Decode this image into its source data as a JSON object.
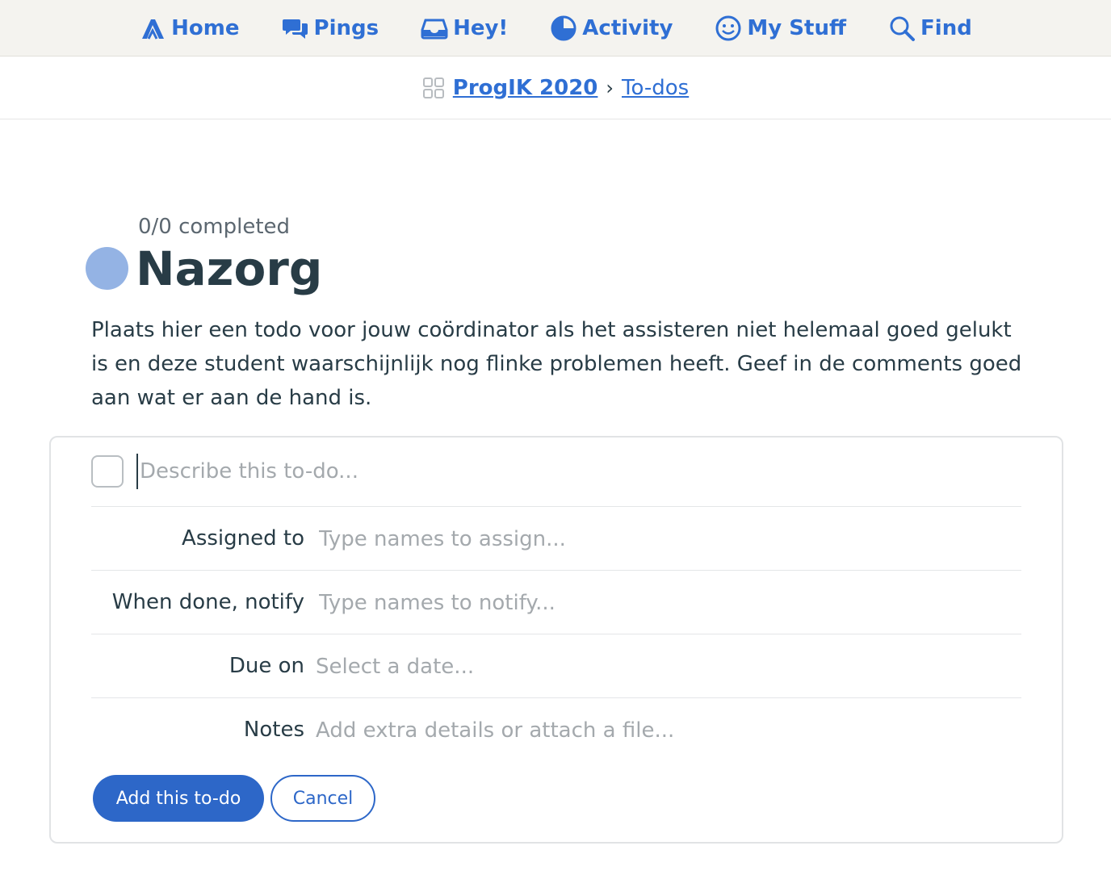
{
  "nav": {
    "items": [
      {
        "label": "Home",
        "icon": "home-icon"
      },
      {
        "label": "Pings",
        "icon": "pings-icon"
      },
      {
        "label": "Hey!",
        "icon": "hey-inbox-icon"
      },
      {
        "label": "Activity",
        "icon": "activity-icon"
      },
      {
        "label": "My Stuff",
        "icon": "smiley-icon"
      },
      {
        "label": "Find",
        "icon": "search-icon"
      }
    ]
  },
  "breadcrumb": {
    "project": "ProgIK 2020",
    "separator": "›",
    "section": "To-dos"
  },
  "list": {
    "progress": "0/0 completed",
    "title": "Nazorg",
    "description": "Plaats hier een todo voor jouw coördinator als het assisteren niet helemaal goed gelukt is en deze student waarschijnlijk nog flinke problemen heeft. Geef in de comments goed aan wat er aan de hand is.",
    "dot_color": "#94b3e4"
  },
  "form": {
    "describe_placeholder": "Describe this to-do...",
    "assigned_label": "Assigned to",
    "assigned_placeholder": "Type names to assign...",
    "notify_label": "When done, notify",
    "notify_placeholder": "Type names to notify...",
    "due_label": "Due on",
    "due_placeholder": "Select a date...",
    "notes_label": "Notes",
    "notes_placeholder": "Add extra details or attach a file...",
    "add_button": "Add this to-do",
    "cancel_button": "Cancel"
  },
  "colors": {
    "accent": "#2f6fd4",
    "primary_button": "#2d67c8",
    "nav_background": "#f4f3ef"
  }
}
